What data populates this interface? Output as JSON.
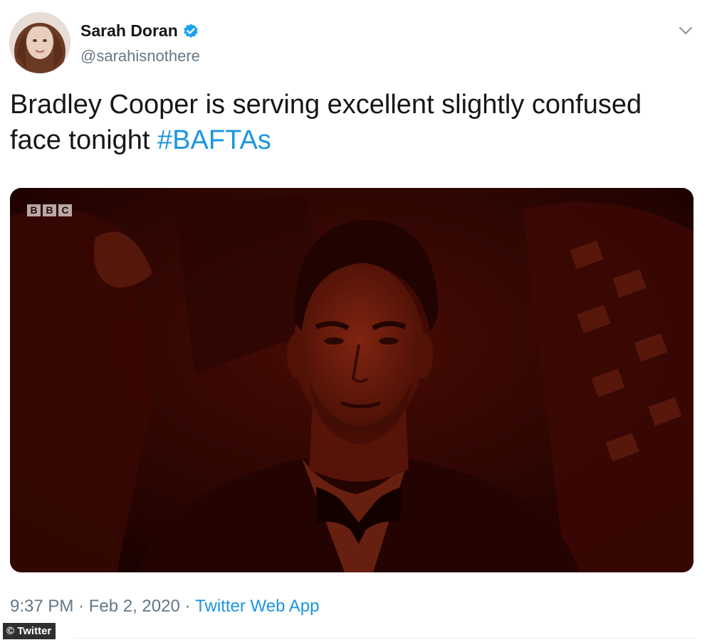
{
  "author": {
    "display_name": "Sarah Doran",
    "handle": "@sarahisnothere",
    "verified": true
  },
  "tweet": {
    "text": "Bradley Cooper is serving excellent slightly confused face tonight",
    "hashtag": "#BAFTAs"
  },
  "media": {
    "channel_logo": [
      "B",
      "B",
      "C"
    ]
  },
  "meta": {
    "time": "9:37 PM",
    "separator": " · ",
    "date": "Feb 2, 2020",
    "source": "Twitter Web App"
  },
  "credit": "© Twitter",
  "icons": {
    "verified": "verified-badge-icon",
    "caret": "chevron-down-icon"
  },
  "colors": {
    "link": "#1b95e0",
    "secondary_text": "#657786",
    "verified_blue": "#1da1f2"
  }
}
